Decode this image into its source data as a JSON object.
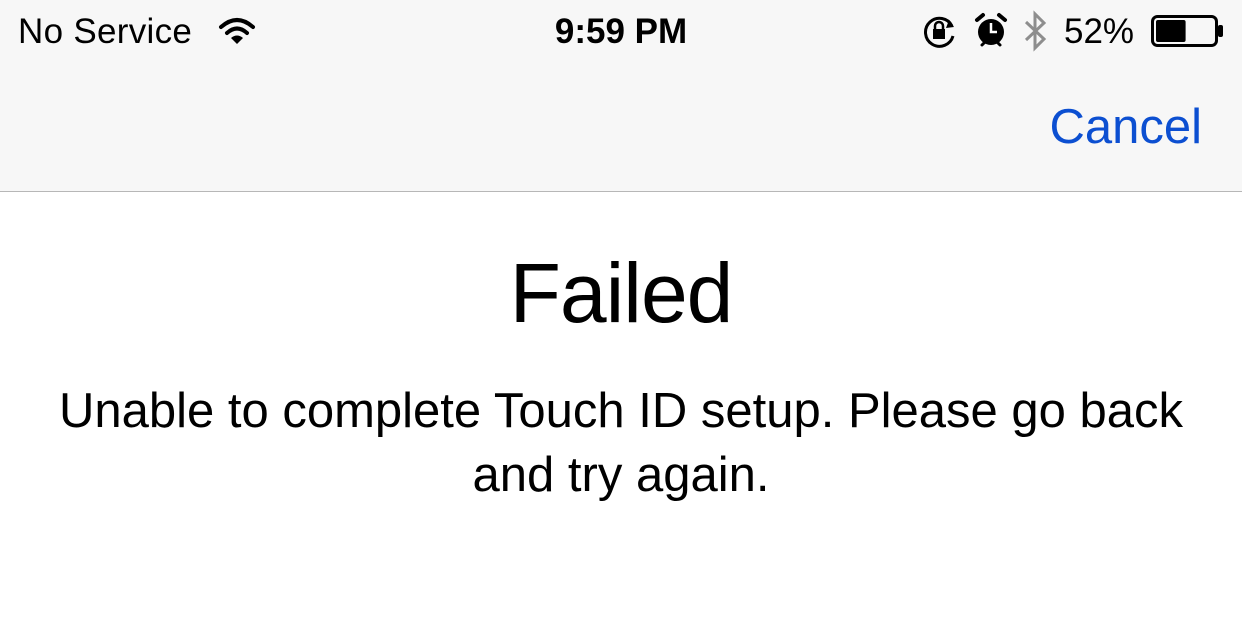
{
  "status_bar": {
    "carrier": "No Service",
    "time": "9:59 PM",
    "battery_percent": "52%",
    "battery_level": 0.52,
    "icons": [
      "wifi-icon",
      "rotation-lock-icon",
      "alarm-icon",
      "bluetooth-icon",
      "battery-icon"
    ]
  },
  "nav_bar": {
    "cancel_label": "Cancel",
    "accent_color": "#0c4fd1"
  },
  "main": {
    "title": "Failed",
    "message": "Unable to complete Touch ID setup. Please go back and try again."
  }
}
